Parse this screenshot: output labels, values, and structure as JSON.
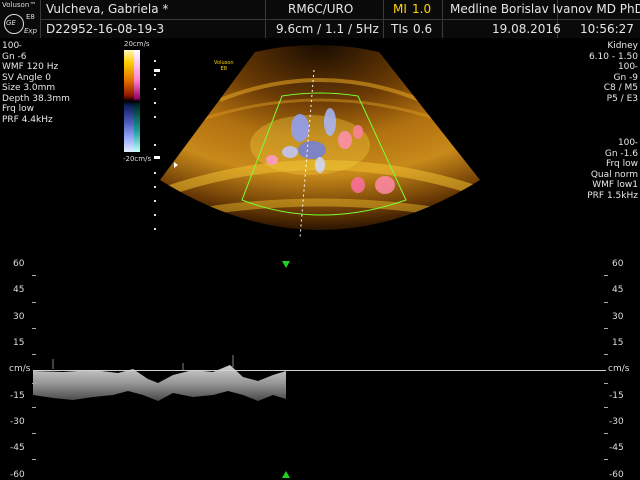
{
  "header": {
    "brand": "Voluson™",
    "model": "E8",
    "edition": "Exp",
    "logo_text": "GE",
    "patient_name": "Vulcheva, Gabriela  *",
    "patient_id": "D22952-16-08-19-3",
    "probe": "RM6C/URO",
    "probe_params": "9.6cm / 1.1 / 5Hz",
    "mi_label": "MI",
    "mi_value": "1.0",
    "tis_label": "TIs",
    "tis_value": "0.6",
    "institution": "Medline Borislav Ivanov MD PhD",
    "date": "19.08.2016",
    "time": "10:56:27"
  },
  "left_params": [
    "100 ̵",
    "Gn -6",
    "WMF 120 Hz",
    "SV Angle  0",
    "Size  3.0mm",
    "Depth 38.3mm",
    "Frq low",
    "PRF  4.4kHz"
  ],
  "right_params_top": [
    "Kidney",
    "6.10 - 1.50",
    "100 ̵",
    "Gn  -9",
    "C8 / M5",
    "P5 / E3"
  ],
  "right_params_bottom": [
    "100 ̵",
    "Gn -1.6",
    "Frq low",
    "Qual norm",
    "WMF low1",
    "PRF  1.5kHz"
  ],
  "colorbar": {
    "top": "20cm/s",
    "bottom": "-20cm/s"
  },
  "image_watermark": {
    "line1": "Voluson",
    "line2": "E8"
  },
  "spectrum": {
    "unit": "cm/s",
    "ticks_left": [
      "60",
      "45",
      "30",
      "15",
      "cm/s",
      "-15",
      "-30",
      "-45",
      "-60"
    ],
    "ticks_right": [
      "60",
      "45",
      "30",
      "15",
      "cm/s",
      "-15",
      "-30",
      "-45",
      "-60"
    ]
  },
  "colors": {
    "mi": "#ffd400",
    "roi_box": "#7cff30",
    "marker": "#20d020"
  }
}
